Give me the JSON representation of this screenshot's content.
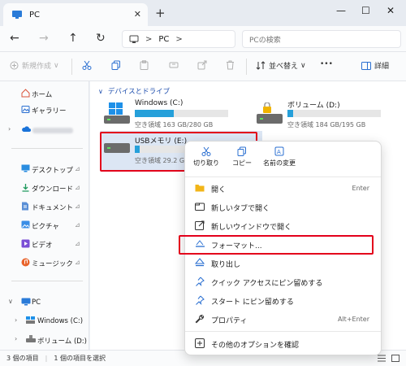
{
  "titlebar": {
    "tab_title": "PC",
    "close_glyph": "✕",
    "newtab_glyph": "+",
    "minimize_glyph": "—",
    "maximize_glyph": "☐",
    "closewin_glyph": "✕"
  },
  "nav": {
    "back": "←",
    "forward": "→",
    "up": "↑",
    "refresh": "↻",
    "address": "PC",
    "crumb_sep": ">",
    "search_placeholder": "PCの検索"
  },
  "toolbar": {
    "new_label": "新規作成",
    "sort_label": "並べ替え",
    "more_label": "•••",
    "details_label": "詳細",
    "view_chevron": "∨"
  },
  "sidebar": {
    "items": [
      {
        "label": "ホーム"
      },
      {
        "label": "ギャラリー"
      },
      {
        "label": "デスクトップ"
      },
      {
        "label": "ダウンロード"
      },
      {
        "label": "ドキュメント"
      },
      {
        "label": "ピクチャ"
      },
      {
        "label": "ビデオ"
      },
      {
        "label": "ミュージック"
      },
      {
        "label": "PC"
      },
      {
        "label": "Windows (C:)"
      },
      {
        "label": "ボリューム (D:)"
      }
    ],
    "pin_glyph": "📌",
    "chevron_right": "›",
    "chevron_down": "∨"
  },
  "content": {
    "section_title": "デバイスとドライブ",
    "drives": [
      {
        "name": "Windows (C:)",
        "free": "空き領域 163 GB/280 GB",
        "used_fraction": 0.42
      },
      {
        "name": "ボリューム (D:)",
        "free": "空き領域 184 GB/195 GB",
        "used_fraction": 0.06
      },
      {
        "name": "USBメモリ (E:)",
        "free": "空き領域 29.2 G",
        "used_fraction": 0.05
      }
    ]
  },
  "status": {
    "count": "3 個の項目",
    "selected": "1 個の項目を選択",
    "sep": "|"
  },
  "context_menu": {
    "top": [
      {
        "label": "切り取り"
      },
      {
        "label": "コピー"
      },
      {
        "label": "名前の変更"
      }
    ],
    "items": [
      {
        "label": "開く",
        "shortcut": "Enter"
      },
      {
        "label": "新しいタブで開く",
        "shortcut": ""
      },
      {
        "label": "新しいウインドウで開く",
        "shortcut": ""
      },
      {
        "label": "フォーマット...",
        "shortcut": ""
      },
      {
        "label": "取り出し",
        "shortcut": ""
      },
      {
        "label": "クイック アクセスにピン留めする",
        "shortcut": ""
      },
      {
        "label": "スタート にピン留めする",
        "shortcut": ""
      },
      {
        "label": "プロパティ",
        "shortcut": "Alt+Enter"
      },
      {
        "label": "その他のオプションを確認",
        "shortcut": ""
      }
    ]
  },
  "colors": {
    "accent": "#26a0da",
    "highlight": "#e3001b",
    "selection": "#dce6f4"
  }
}
